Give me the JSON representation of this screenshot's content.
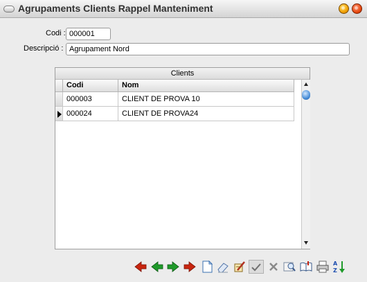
{
  "window": {
    "title": "Agrupaments Clients Rappel Manteniment"
  },
  "form": {
    "codi_label": "Codi :",
    "codi_value": "000001",
    "descripcio_label": "Descripció :",
    "descripcio_value": "Agrupament Nord"
  },
  "grid": {
    "caption": "Clients",
    "columns": [
      "Codi",
      "Nom"
    ],
    "rows": [
      {
        "codi": "000003",
        "nom": "CLIENT DE PROVA 10"
      },
      {
        "codi": "000024",
        "nom": "CLIENT DE PROVA24"
      }
    ],
    "current_row": 1
  },
  "toolbar": {
    "icons": [
      "first-icon",
      "previous-icon",
      "next-icon",
      "last-icon",
      "new-record-icon",
      "erase-icon",
      "edit-icon",
      "confirm-icon",
      "cancel-icon",
      "search-icon",
      "book-icon",
      "print-icon",
      "sort-az-icon"
    ]
  },
  "colors": {
    "nav_red": "#c8250f",
    "nav_green": "#1f9a2a",
    "accent_blue": "#4a8fd8"
  }
}
